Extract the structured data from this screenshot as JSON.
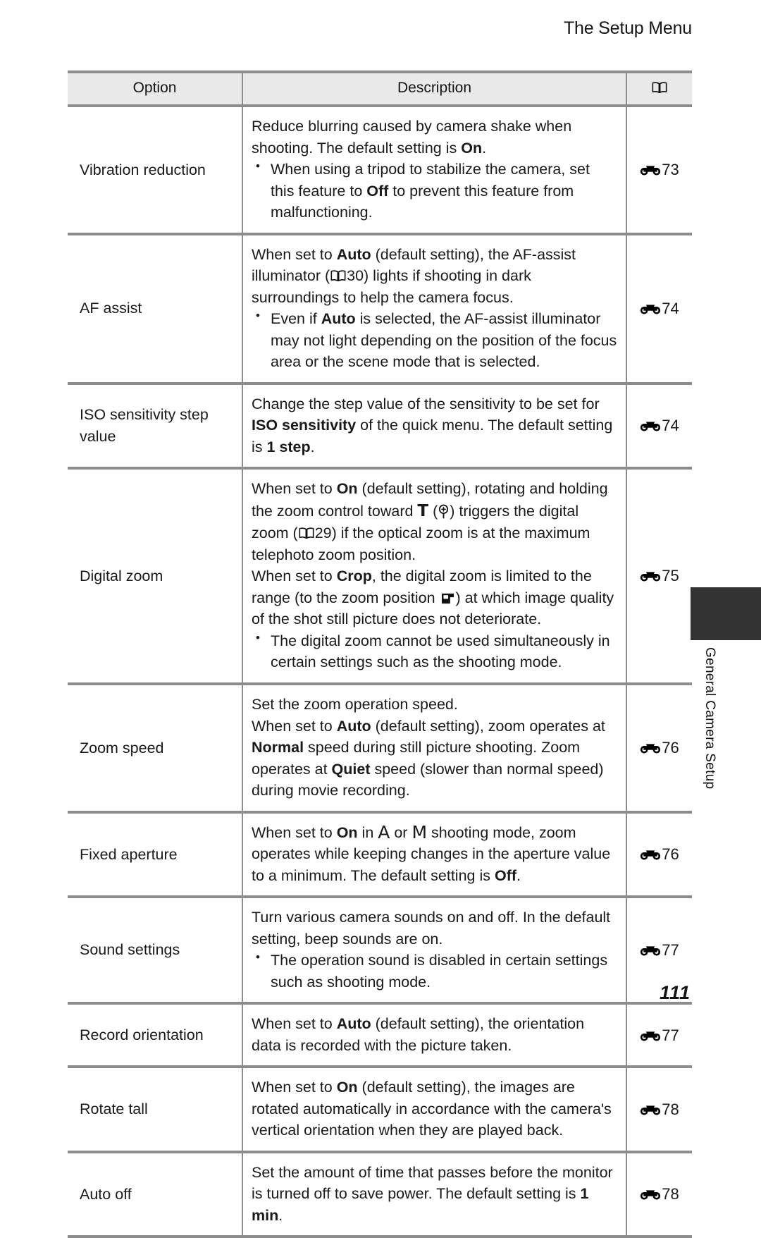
{
  "header": {
    "title": "The Setup Menu"
  },
  "side_tab": {
    "label": "General Camera Setup"
  },
  "page_number": "111",
  "table": {
    "columns": {
      "option": "Option",
      "description": "Description",
      "reference_icon": "open-book-icon"
    },
    "rows": [
      {
        "option": "Vibration reduction",
        "ref_page": "73",
        "paragraphs": [
          "Reduce blurring caused by camera shake when shooting. The default setting is On."
        ],
        "bullets": [
          "When using a tripod to stabilize the camera, set this feature to Off to prevent this feature from malfunctioning."
        ],
        "bold_terms": [
          "On",
          "Off"
        ]
      },
      {
        "option": "AF assist",
        "ref_page": "74",
        "paragraphs": [
          "When set to Auto (default setting), the AF-assist illuminator (A30) lights if shooting in dark surroundings to help the camera focus."
        ],
        "bullets": [
          "Even if Auto is selected, the AF-assist illuminator may not light depending on the position of the focus area or the scene mode that is selected."
        ],
        "bold_terms": [
          "Auto"
        ],
        "inline_refs": [
          "30"
        ]
      },
      {
        "option": "ISO sensitivity step value",
        "ref_page": "74",
        "paragraphs": [
          "Change the step value of the sensitivity to be set for ISO sensitivity of the quick menu. The default setting is 1 step."
        ],
        "bullets": [],
        "bold_terms": [
          "ISO sensitivity",
          "1 step"
        ]
      },
      {
        "option": "Digital zoom",
        "ref_page": "75",
        "paragraphs": [
          "When set to On (default setting), rotating and holding the zoom control toward T (zoom-in icon) triggers the digital zoom (A29) if the optical zoom is at the maximum telephoto zoom position.",
          "When set to Crop, the digital zoom is limited to the range (to the zoom position crop-icon) at which image quality of the shot still picture does not deteriorate."
        ],
        "bullets": [
          "The digital zoom cannot be used simultaneously in certain settings such as the shooting mode."
        ],
        "bold_terms": [
          "On",
          "Crop",
          "T"
        ],
        "inline_refs": [
          "29"
        ]
      },
      {
        "option": "Zoom speed",
        "ref_page": "76",
        "paragraphs": [
          "Set the zoom operation speed.",
          "When set to Auto (default setting), zoom operates at Normal speed during still picture shooting. Zoom operates at Quiet speed (slower than normal speed) during movie recording."
        ],
        "bullets": [],
        "bold_terms": [
          "Auto",
          "Normal",
          "Quiet"
        ]
      },
      {
        "option": "Fixed aperture",
        "ref_page": "76",
        "paragraphs": [
          "When set to On in A or M shooting mode, zoom operates while keeping changes in the aperture value to a minimum. The default setting is Off."
        ],
        "bullets": [],
        "bold_terms": [
          "On",
          "Off"
        ],
        "mode_glyphs": [
          "A",
          "M"
        ]
      },
      {
        "option": "Sound settings",
        "ref_page": "77",
        "paragraphs": [
          "Turn various camera sounds on and off. In the default setting, beep sounds are on."
        ],
        "bullets": [
          "The operation sound is disabled in certain settings such as shooting mode."
        ],
        "bold_terms": []
      },
      {
        "option": "Record orientation",
        "ref_page": "77",
        "paragraphs": [
          "When set to Auto (default setting), the orientation data is recorded with the picture taken."
        ],
        "bullets": [],
        "bold_terms": [
          "Auto"
        ]
      },
      {
        "option": "Rotate tall",
        "ref_page": "78",
        "paragraphs": [
          "When set to On (default setting), the images are rotated automatically in accordance with the camera's vertical orientation when they are played back."
        ],
        "bullets": [],
        "bold_terms": [
          "On"
        ]
      },
      {
        "option": "Auto off",
        "ref_page": "78",
        "paragraphs": [
          "Set the amount of time that passes before the monitor is turned off to save power. The default setting is 1 min."
        ],
        "bullets": [],
        "bold_terms": [
          "1 min"
        ]
      }
    ]
  },
  "text_fragments": {
    "vr_p1_a": "Reduce blurring caused by camera shake when shooting. The default setting is ",
    "vr_p1_b": "On",
    "vr_p1_c": ".",
    "vr_b1_a": "When using a tripod to stabilize the camera, set this feature to ",
    "vr_b1_b": "Off",
    "vr_b1_c": " to prevent this feature from malfunctioning.",
    "af_p1_a": "When set to ",
    "af_p1_b": "Auto",
    "af_p1_c": " (default setting), the AF-assist illuminator (",
    "af_p1_d": "30) lights if shooting in dark surroundings to help the camera focus.",
    "af_b1_a": "Even if ",
    "af_b1_b": "Auto",
    "af_b1_c": " is selected, the AF-assist illuminator may not light depending on the position of the focus area or the scene mode that is selected.",
    "iso_p1_a": "Change the step value of the sensitivity to be set for ",
    "iso_p1_b": "ISO sensitivity",
    "iso_p1_c": " of the quick menu. The default setting is ",
    "iso_p1_d": "1 step",
    "iso_p1_e": ".",
    "dz_p1_a": "When set to ",
    "dz_p1_b": "On",
    "dz_p1_c": " (default setting), rotating and holding the zoom control toward ",
    "dz_p1_t": "T",
    "dz_p1_d": " (",
    "dz_p1_e": ") triggers the digital zoom (",
    "dz_p1_f": "29) if the optical zoom is at the maximum telephoto zoom position.",
    "dz_p2_a": "When set to ",
    "dz_p2_b": "Crop",
    "dz_p2_c": ", the digital zoom is limited to the range (to the zoom position ",
    "dz_p2_d": ") at which image quality of the shot still picture does not deteriorate.",
    "dz_b1": "The digital zoom cannot be used simultaneously in certain settings such as the shooting mode.",
    "zs_p1": "Set the zoom operation speed.",
    "zs_p2_a": "When set to ",
    "zs_p2_b": "Auto",
    "zs_p2_c": " (default setting), zoom operates at ",
    "zs_p2_d": "Normal",
    "zs_p2_e": " speed during still picture shooting. Zoom operates at ",
    "zs_p2_f": "Quiet",
    "zs_p2_g": " speed (slower than normal speed) during movie recording.",
    "fa_p1_a": "When set to ",
    "fa_p1_b": "On",
    "fa_p1_c": " in ",
    "fa_p1_modea": "A",
    "fa_p1_d": " or ",
    "fa_p1_modeb": "M",
    "fa_p1_e": " shooting mode, zoom operates while keeping changes in the aperture value to a minimum. The default setting is ",
    "fa_p1_f": "Off",
    "fa_p1_g": ".",
    "ss_p1": "Turn various camera sounds on and off. In the default setting, beep sounds are on.",
    "ss_b1": "The operation sound is disabled in certain settings such as shooting mode.",
    "ro_p1_a": "When set to ",
    "ro_p1_b": "Auto",
    "ro_p1_c": " (default setting), the orientation data is recorded with the picture taken.",
    "rt_p1_a": "When set to ",
    "rt_p1_b": "On",
    "rt_p1_c": " (default setting), the images are rotated automatically in accordance with the camera's vertical orientation when they are played back.",
    "ao_p1_a": "Set the amount of time that passes before the monitor is turned off to save power. The default setting is ",
    "ao_p1_b": "1 min",
    "ao_p1_c": "."
  },
  "ref_pages": {
    "r0": "73",
    "r1": "74",
    "r2": "74",
    "r3": "75",
    "r4": "76",
    "r5": "76",
    "r6": "77",
    "r7": "77",
    "r8": "78",
    "r9": "78"
  },
  "options": {
    "o0": "Vibration reduction",
    "o1": "AF assist",
    "o2": "ISO sensitivity step value",
    "o3": "Digital zoom",
    "o4": "Zoom speed",
    "o5": "Fixed aperture",
    "o6": "Sound settings",
    "o7": "Record orientation",
    "o8": "Rotate tall",
    "o9": "Auto off"
  },
  "colors": {
    "rule": "#8c8c8c",
    "header_bg": "#e9e9e9",
    "tab_dark": "#333333",
    "text": "#1a1a1a"
  }
}
